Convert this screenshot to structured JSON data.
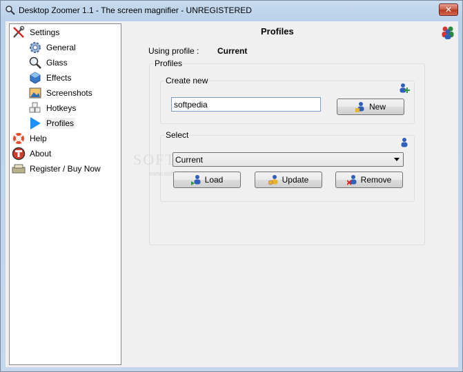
{
  "window": {
    "title": "Desktop Zoomer 1.1 - The screen magnifier - UNREGISTERED",
    "close_glyph": "✕"
  },
  "sidebar": {
    "items": [
      {
        "label": "Settings",
        "icon": "settings-tools-icon"
      },
      {
        "label": "General",
        "icon": "gear-icon"
      },
      {
        "label": "Glass",
        "icon": "magnifier-icon"
      },
      {
        "label": "Effects",
        "icon": "cube-icon"
      },
      {
        "label": "Screenshots",
        "icon": "picture-icon"
      },
      {
        "label": "Hotkeys",
        "icon": "keys-icon"
      },
      {
        "label": "Profiles",
        "icon": "play-arrow-icon",
        "selected": true
      },
      {
        "label": "Help",
        "icon": "lifebuoy-icon"
      },
      {
        "label": "About",
        "icon": "about-t-icon"
      },
      {
        "label": "Register / Buy Now",
        "icon": "register-icon"
      }
    ]
  },
  "main": {
    "title": "Profiles",
    "using_label": "Using profile :",
    "using_value": "Current",
    "profiles_group": "Profiles",
    "create_group": "Create new",
    "new_name_value": "softpedia",
    "new_button": "New",
    "select_group": "Select",
    "selected_profile": "Current",
    "load_button": "Load",
    "update_button": "Update",
    "remove_button": "Remove"
  },
  "watermark": {
    "text": "SOFTPEDIA",
    "mark": "®",
    "url": "www.softpedia.com"
  },
  "colors": {
    "title_bar": "#b9d1ea",
    "close_button": "#c75a45",
    "selection_arrow": "#1e90ff"
  }
}
